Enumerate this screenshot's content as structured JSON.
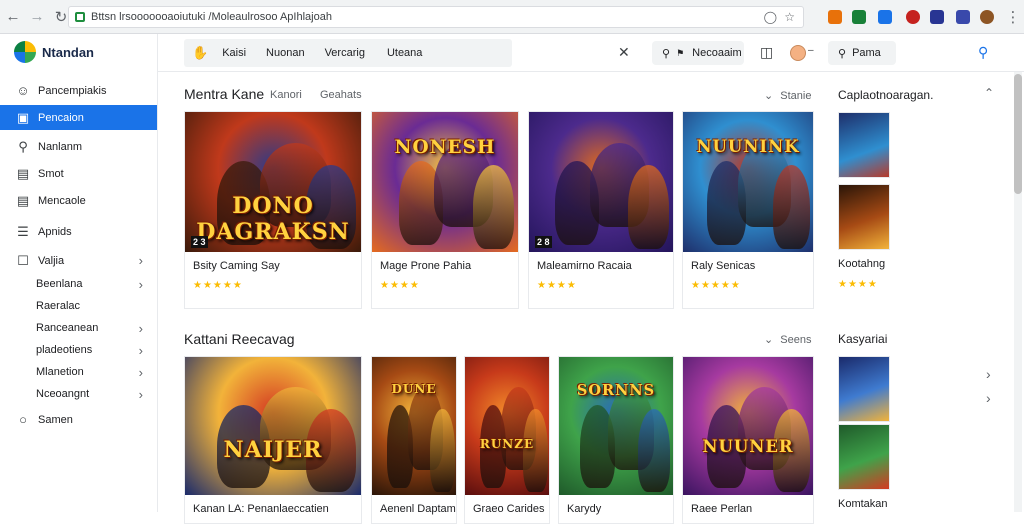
{
  "browser": {
    "url": "Bttsn lrsooooooaoiutuki /Moleaulrosoo ApIhlajoah"
  },
  "brand": {
    "name": "Ntandan"
  },
  "sidebar": {
    "items": [
      {
        "label": "Pancempiakis",
        "icon": "person-icon",
        "active": false
      },
      {
        "label": "Pencaion",
        "icon": "bookmark-icon",
        "active": true
      },
      {
        "label": "Nanlanm",
        "icon": "search-icon",
        "active": false
      },
      {
        "label": "Smot",
        "icon": "book-icon",
        "active": false
      },
      {
        "label": "Mencaole",
        "icon": "document-icon",
        "active": false
      },
      {
        "label": "Apnids",
        "icon": "list-icon",
        "active": false
      },
      {
        "label": "Valjia",
        "icon": "square-icon",
        "active": false
      }
    ],
    "subitems": [
      {
        "label": "Beenlana"
      },
      {
        "label": "Raeralac"
      },
      {
        "label": "Ranceanean"
      },
      {
        "label": "pladeotiens"
      },
      {
        "label": "Mlanetion"
      },
      {
        "label": "Nceoangnt"
      }
    ],
    "footer_item": {
      "label": "Samen",
      "icon": "circle-icon"
    }
  },
  "topbar": {
    "tabs": [
      "Kaisi",
      "Nuonan",
      "Vercarig",
      "Uteana"
    ],
    "notifications_label": "Necoaaim",
    "search_label": "Pama"
  },
  "section1": {
    "title": "Mentra Kane",
    "tabs": [
      "Kanori",
      "Geahats"
    ],
    "more_label": "Stanie",
    "cards": [
      {
        "name": "Bsity Caming Say",
        "stars": "★★★★★",
        "badge": "2 3",
        "art_title": "DONO DAGRAKSN",
        "colors": [
          "#3a1a0a",
          "#c0391b",
          "#2b3a8a"
        ]
      },
      {
        "name": "Mage Prone Pahia",
        "stars": "★★★★",
        "badge": "",
        "art_title": "NONESH",
        "colors": [
          "#e56b1f",
          "#6a2b94",
          "#f5c242"
        ]
      },
      {
        "name": "Maleamirno Racaia",
        "stars": "★★★★",
        "badge": "2 8",
        "art_title": "",
        "colors": [
          "#23155a",
          "#4c2a8c",
          "#e06b1e"
        ]
      },
      {
        "name": "Raly Senicas",
        "stars": "★★★★★",
        "badge": "",
        "art_title": "NUUNINK",
        "colors": [
          "#1e2f6b",
          "#2f8fd0",
          "#b73a2a"
        ]
      }
    ]
  },
  "section2": {
    "title": "Kattani Reecavag",
    "more_label": "Seens",
    "cards": [
      {
        "name": "Kanan LA: Penanlaeccatien",
        "art_title": "NAIJER",
        "colors": [
          "#1a2a6b",
          "#f2b33a",
          "#d33a22"
        ]
      },
      {
        "name": "Aenenl Daptam",
        "art_title": "DUNE",
        "colors": [
          "#2a1508",
          "#a64a14",
          "#f2b33a"
        ]
      },
      {
        "name": "Graeo Carides",
        "art_title": "RUNZE",
        "colors": [
          "#5a0e0e",
          "#c73a1a",
          "#f28b2a"
        ]
      },
      {
        "name": "Karydy",
        "art_title": "SORNNS",
        "colors": [
          "#1f5a2a",
          "#3fa34a",
          "#2a6bb8"
        ]
      },
      {
        "name": "Raee Perlan",
        "art_title": "NUUNER",
        "colors": [
          "#3a1460",
          "#a63aa0",
          "#f2b33a"
        ]
      }
    ]
  },
  "right_panel": {
    "title1": "Caplaotnoaragan.",
    "item1_name": "Kootahng",
    "item1_stars": "★★★★",
    "title2": "Kasyariai",
    "item2_name": "Komtakan"
  }
}
